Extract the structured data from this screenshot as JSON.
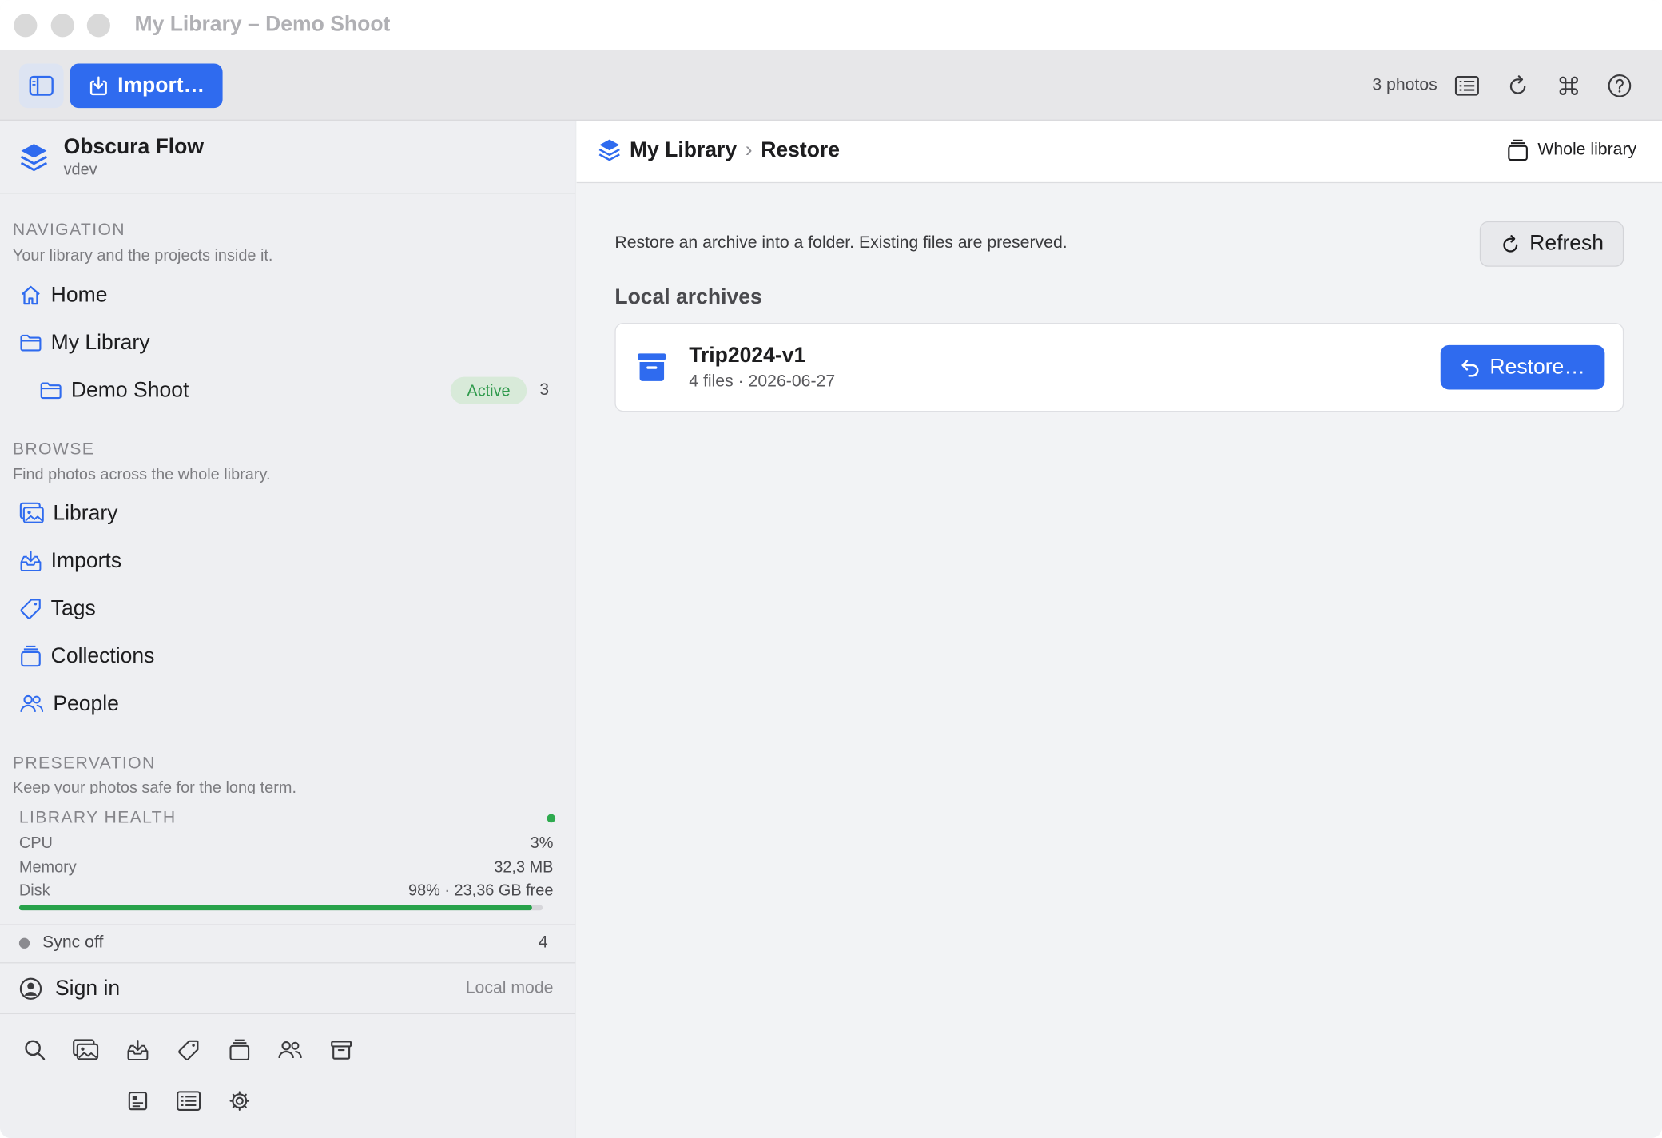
{
  "window": {
    "title": "My Library – Demo Shoot"
  },
  "toolbar": {
    "import_label": "Import…",
    "photo_count": "3 photos"
  },
  "sidebar": {
    "app_name": "Obscura Flow",
    "app_version": "vdev",
    "navigation": {
      "title": "NAVIGATION",
      "subtitle": "Your library and the projects inside it.",
      "items": [
        {
          "label": "Home",
          "icon": "home-icon"
        },
        {
          "label": "My Library",
          "icon": "folder-icon"
        },
        {
          "label": "Demo Shoot",
          "icon": "folder-icon",
          "badge": "Active",
          "count": "3"
        }
      ]
    },
    "browse": {
      "title": "BROWSE",
      "subtitle": "Find photos across the whole library.",
      "items": [
        {
          "label": "Library",
          "icon": "photos-icon"
        },
        {
          "label": "Imports",
          "icon": "tray-download-icon"
        },
        {
          "label": "Tags",
          "icon": "tag-icon"
        },
        {
          "label": "Collections",
          "icon": "stack-icon"
        },
        {
          "label": "People",
          "icon": "people-icon"
        }
      ]
    },
    "preservation": {
      "title": "PRESERVATION",
      "subtitle": "Keep your photos safe for the long term."
    },
    "health": {
      "title": "LIBRARY HEALTH",
      "status_color": "#2eaa4f",
      "cpu_label": "CPU",
      "cpu_value": "3%",
      "memory_label": "Memory",
      "memory_value": "32,3 MB",
      "disk_label": "Disk",
      "disk_value": "98% · 23,36 GB free",
      "disk_fraction": 0.98
    },
    "sync": {
      "label": "Sync off",
      "count": "4"
    },
    "account": {
      "label": "Sign in",
      "mode": "Local mode"
    }
  },
  "main": {
    "breadcrumb": {
      "root": "My Library",
      "separator": "›",
      "current": "Restore"
    },
    "scope_label": "Whole library",
    "description": "Restore an archive into a folder. Existing files are preserved.",
    "refresh_label": "Refresh",
    "archives_heading": "Local archives",
    "archives": [
      {
        "name": "Trip2024-v1",
        "meta": "4 files · 2026-06-27",
        "action": "Restore…"
      }
    ]
  },
  "colors": {
    "accent": "#2f6bef",
    "success": "#2eaa4f",
    "sidebar_bg": "#eeeff2"
  }
}
